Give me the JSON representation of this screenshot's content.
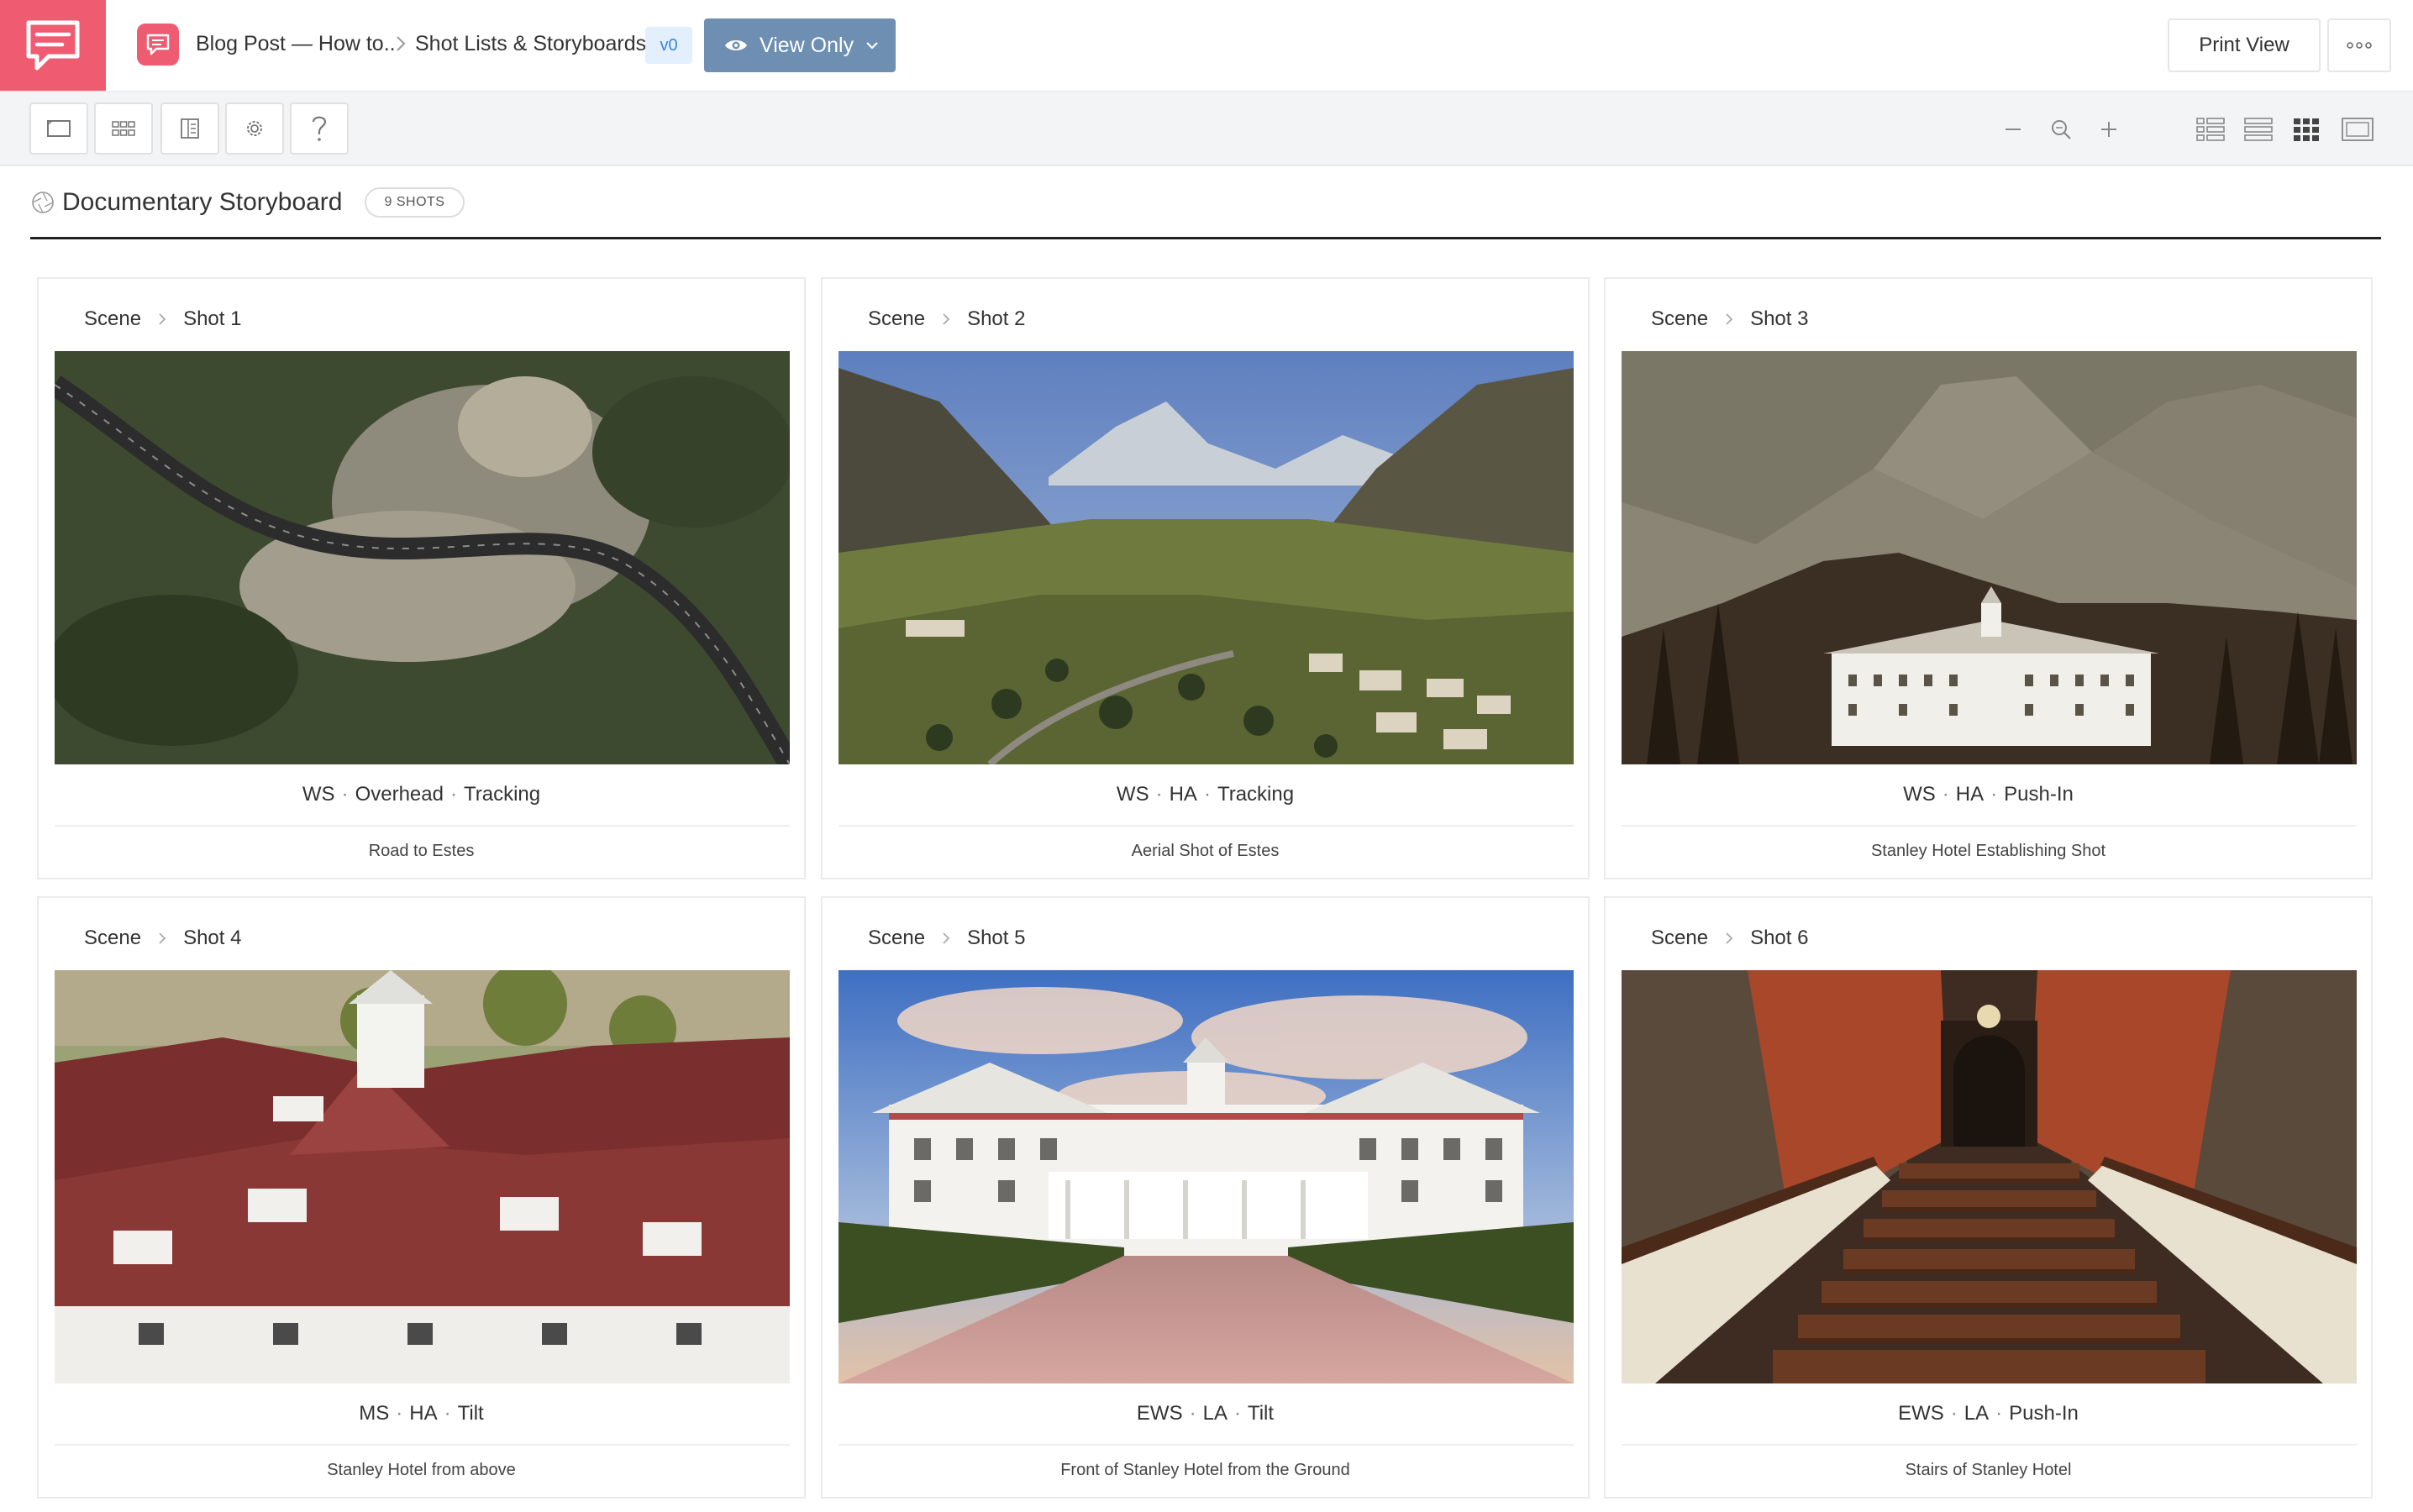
{
  "header": {
    "breadcrumb_project": "Blog Post — How to..",
    "breadcrumb_page": "Shot Lists & Storyboards",
    "version": "v0",
    "view_mode": "View Only",
    "print_label": "Print View"
  },
  "board": {
    "title": "Documentary Storyboard",
    "shot_count": "9 SHOTS"
  },
  "shots": [
    {
      "scene": "Scene",
      "shot": "Shot 1",
      "size": "WS",
      "angle": "Overhead",
      "movement": "Tracking",
      "description": "Road to Estes"
    },
    {
      "scene": "Scene",
      "shot": "Shot 2",
      "size": "WS",
      "angle": "HA",
      "movement": "Tracking",
      "description": "Aerial Shot of Estes"
    },
    {
      "scene": "Scene",
      "shot": "Shot 3",
      "size": "WS",
      "angle": "HA",
      "movement": "Push-In",
      "description": "Stanley Hotel Establishing Shot"
    },
    {
      "scene": "Scene",
      "shot": "Shot 4",
      "size": "MS",
      "angle": "HA",
      "movement": "Tilt",
      "description": "Stanley Hotel from above"
    },
    {
      "scene": "Scene",
      "shot": "Shot 5",
      "size": "EWS",
      "angle": "LA",
      "movement": "Tilt",
      "description": "Front of Stanley Hotel from the Ground"
    },
    {
      "scene": "Scene",
      "shot": "Shot 6",
      "size": "EWS",
      "angle": "LA",
      "movement": "Push-In",
      "description": "Stairs of Stanley Hotel"
    }
  ],
  "colors": {
    "brand": "#ef5b70",
    "view_button": "#6e8eb2",
    "version_badge_bg": "#e3effc"
  },
  "icons": {
    "toolbar": [
      "frame-icon",
      "grid-icon",
      "panel-icon",
      "gear-icon",
      "help-icon"
    ],
    "zoom": [
      "zoom-out-icon",
      "zoom-reset-icon",
      "zoom-in-icon"
    ],
    "layouts": [
      "list-layout-icon",
      "rows-layout-icon",
      "grid-layout-icon",
      "film-layout-icon"
    ]
  }
}
